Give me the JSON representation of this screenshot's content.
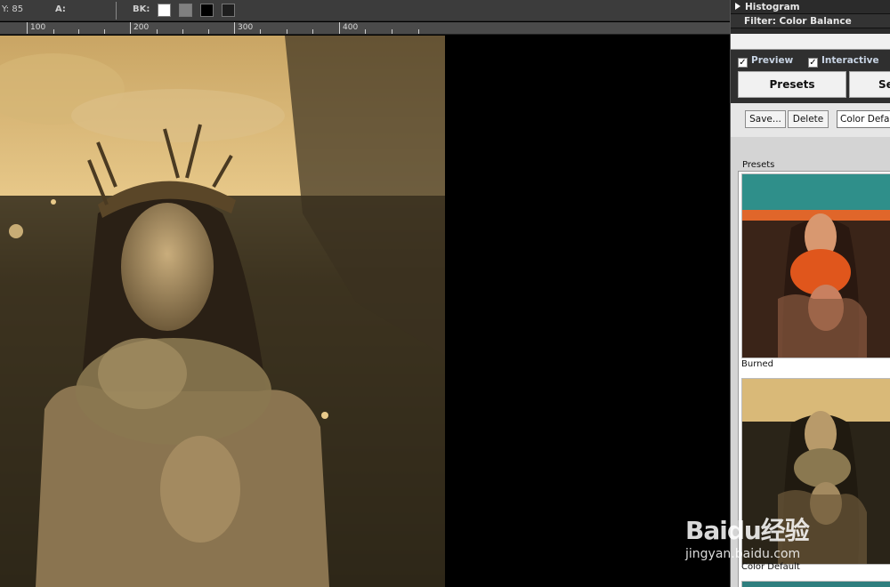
{
  "status_bar": {
    "y_label": "Y: 85",
    "a_label": "A:",
    "bk_label": "BK:",
    "swatches": [
      "#ffffff",
      "#808080",
      "#000000",
      "#1e1e1e"
    ]
  },
  "ruler": {
    "labels": [
      "100",
      "200",
      "300",
      "400"
    ]
  },
  "panel": {
    "histogram_title": "Histogram",
    "filter_title": "Filter: Color Balance",
    "preview_label": "Preview",
    "interactive_label": "Interactive",
    "tab_presets": "Presets",
    "tab_second": "Se",
    "save_label": "Save...",
    "delete_label": "Delete",
    "preset_select_value": "Color Default",
    "presets_label": "Presets",
    "thumbnails": [
      {
        "label": "Burned"
      },
      {
        "label": "Color Default"
      }
    ]
  },
  "watermark": {
    "brand": "Baidu经验",
    "url": "jingyan.baidu.com"
  },
  "colors": {
    "sepia_light": "#e8c98a",
    "sepia_dark": "#2a2418",
    "panel_bg": "#d4d4d4"
  }
}
